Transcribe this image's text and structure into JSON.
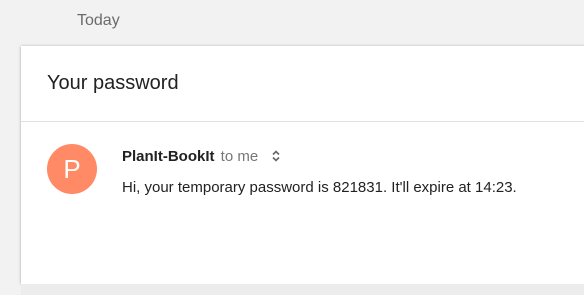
{
  "date_header": "Today",
  "email": {
    "subject": "Your password",
    "avatar": {
      "letter": "P",
      "color": "#ff8a65"
    },
    "sender_name": "PlanIt-BookIt",
    "recipient": "to me",
    "expand_icon": "chevron-up-down-icon",
    "body": "Hi, your temporary password is 821831. It'll expire at 14:23."
  }
}
